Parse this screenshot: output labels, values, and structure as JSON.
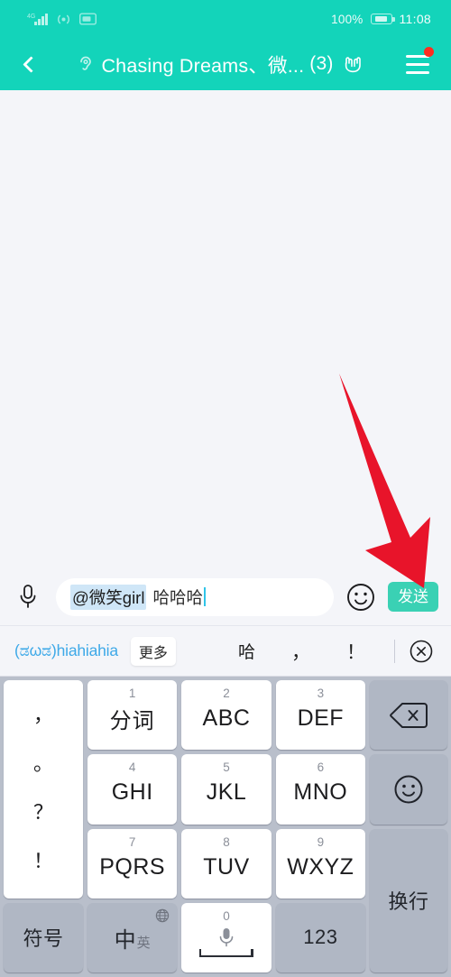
{
  "statusbar": {
    "battery_percent": "100%",
    "time": "11:08",
    "icons": [
      "signal-bars-icon",
      "hotspot-icon",
      "sim-card-icon",
      "battery-icon"
    ]
  },
  "header": {
    "back_icon": "back-chevron-icon",
    "ear_icon": "ear-listen-icon",
    "title": "Chasing Dreams、微...",
    "member_count": "(3)",
    "rock_icon": "rock-hand-icon",
    "menu_icon": "hamburger-menu-icon",
    "has_menu_badge": true,
    "accent_color": "#13d4ba"
  },
  "input_bar": {
    "mic_icon": "microphone-icon",
    "mention_chip": "@微笑girl",
    "typed_text": "哈哈哈",
    "placeholder": "",
    "emoji_icon": "smiley-face-icon",
    "send_label": "发送",
    "send_color": "#3ad1b4"
  },
  "suggestion_bar": {
    "emoticon": "(ಡωಡ)hiahiahia",
    "more_label": "更多",
    "candidates": [
      "哈",
      "，",
      "！"
    ],
    "close_icon": "close-circle-icon"
  },
  "keyboard": {
    "punct_key": {
      "name": "punctuation-key",
      "chars": [
        "，",
        "。",
        "？",
        "！"
      ]
    },
    "digit_keys": [
      {
        "num": "1",
        "label": "分词",
        "cn": true
      },
      {
        "num": "2",
        "label": "ABC",
        "cn": false
      },
      {
        "num": "3",
        "label": "DEF",
        "cn": false
      },
      {
        "num": "4",
        "label": "GHI",
        "cn": false
      },
      {
        "num": "5",
        "label": "JKL",
        "cn": false
      },
      {
        "num": "6",
        "label": "MNO",
        "cn": false
      },
      {
        "num": "7",
        "label": "PQRS",
        "cn": false
      },
      {
        "num": "8",
        "label": "TUV",
        "cn": false
      },
      {
        "num": "9",
        "label": "WXYZ",
        "cn": false
      }
    ],
    "backspace_icon": "backspace-delete-icon",
    "emoji_icon": "smiley-face-icon",
    "enter_label": "换行",
    "symbol_label": "符号",
    "lang_cn": "中",
    "lang_en": "英",
    "lang_globe_icon": "globe-icon",
    "space_num": "0",
    "space_mic_icon": "microphone-icon",
    "numeric_label": "123",
    "bg_color": "#b9bfcb"
  },
  "annotation": {
    "arrow": "red-arrow-pointing-to-send-button",
    "color": "#e8142a"
  }
}
